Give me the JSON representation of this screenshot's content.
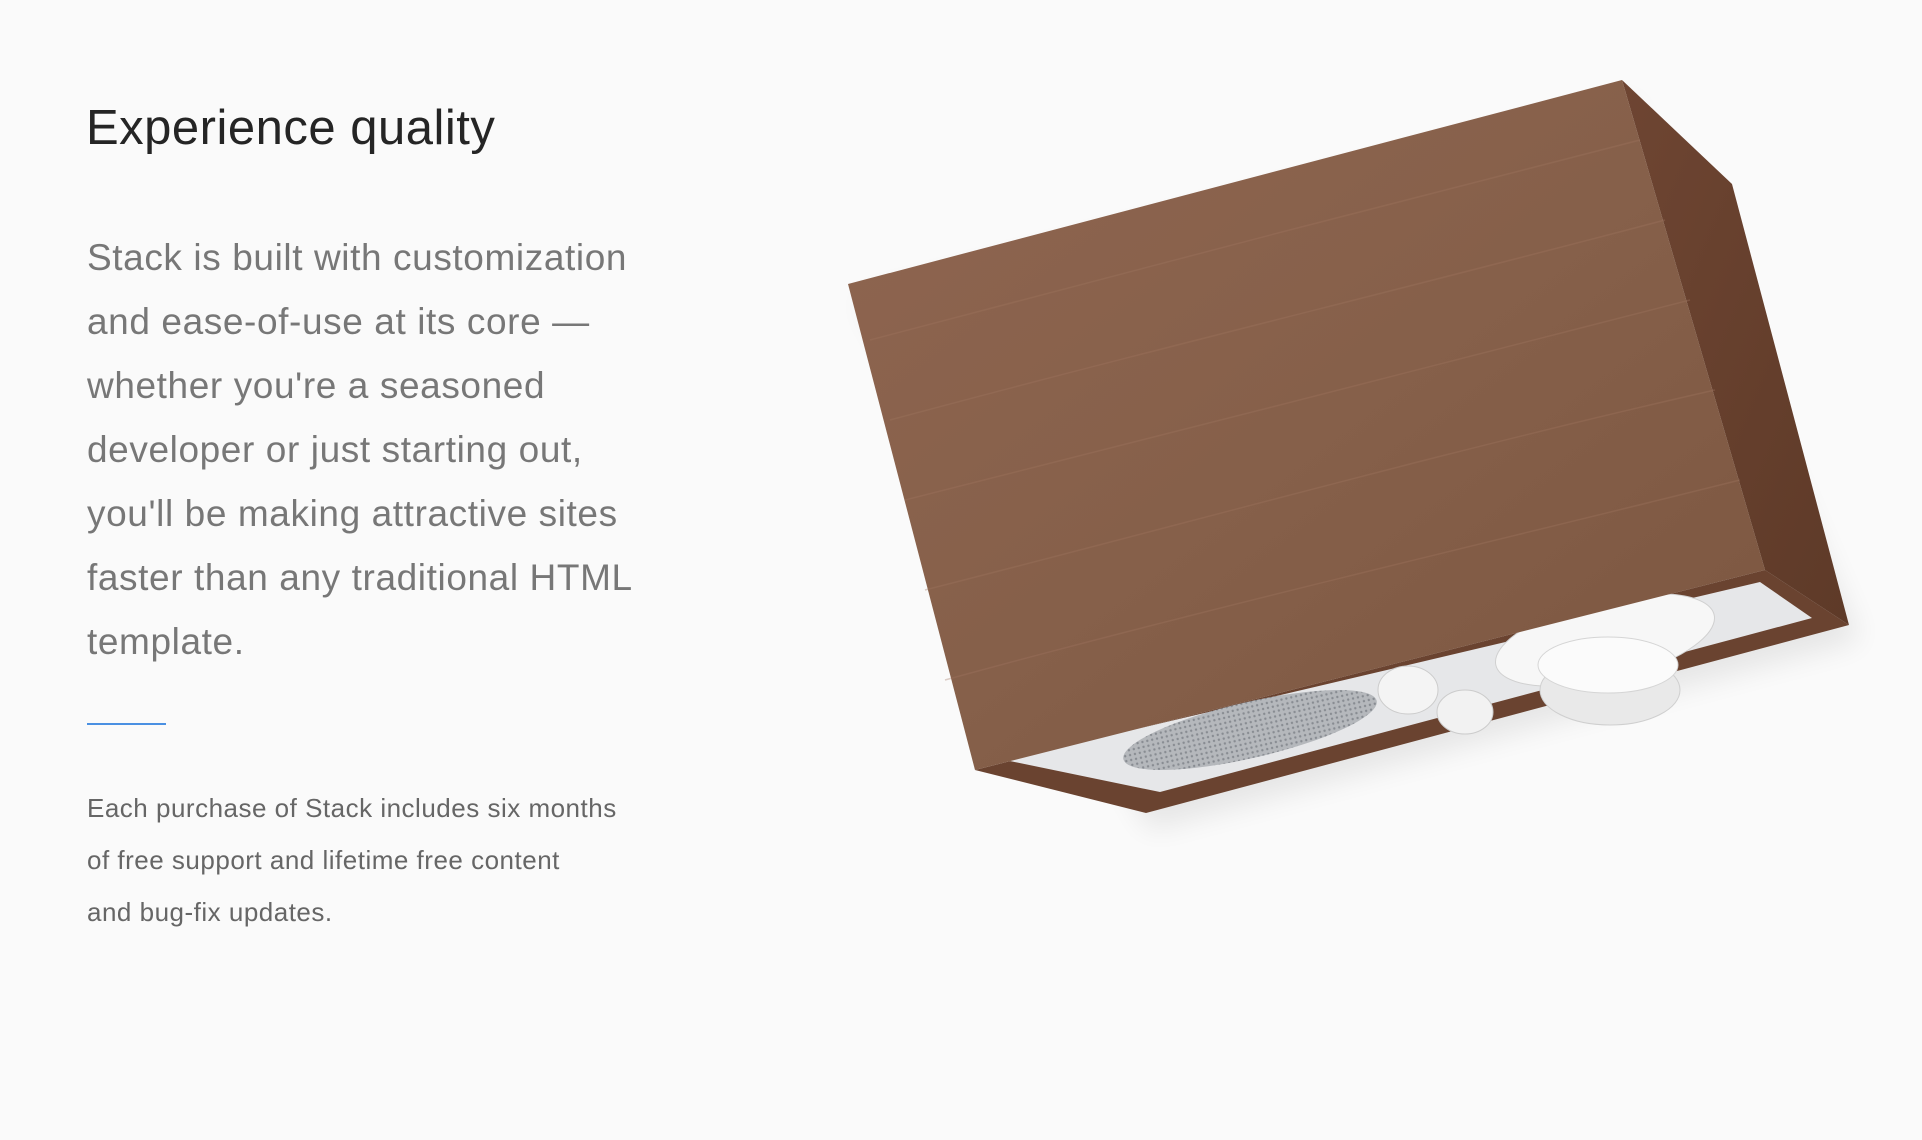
{
  "section": {
    "title": "Experience quality",
    "lead_lines": [
      "Stack is built with customization",
      "and ease-of-use at its core —",
      "whether you're a seasoned",
      "developer or just starting out,",
      "you'll be making attractive sites",
      "faster than any traditional HTML",
      "template."
    ],
    "body_lines": [
      "Each purchase of Stack includes six months",
      "of free support and lifetime free content",
      "and bug-fix updates."
    ]
  },
  "colors": {
    "accent": "#4a90e2",
    "background": "#fafafa",
    "wood": "#8a5e45"
  },
  "image": {
    "subject": "wooden-radio"
  }
}
